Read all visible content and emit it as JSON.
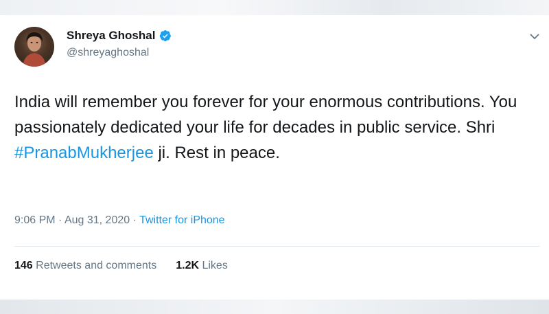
{
  "tweet": {
    "author": {
      "display_name": "Shreya Ghoshal",
      "handle": "@shreyaghoshal",
      "verified_icon": "verified-badge-icon"
    },
    "text": {
      "part1": "India will remember you forever for your enormous contributions. You passionately dedicated your life for decades in public service. Shri ",
      "hashtag": "#PranabMukherjee",
      "part2": " ji. Rest in peace."
    },
    "meta": {
      "time": "9:06 PM",
      "separator1": " · ",
      "date": "Aug 31, 2020",
      "separator2": " · ",
      "source": "Twitter for iPhone"
    },
    "stats": {
      "retweets_count": "146",
      "retweets_label": " Retweets and comments",
      "likes_count": "1.2K",
      "likes_label": " Likes"
    },
    "colors": {
      "link": "#1b95e0",
      "text": "#14171a",
      "secondary": "#657786"
    }
  }
}
